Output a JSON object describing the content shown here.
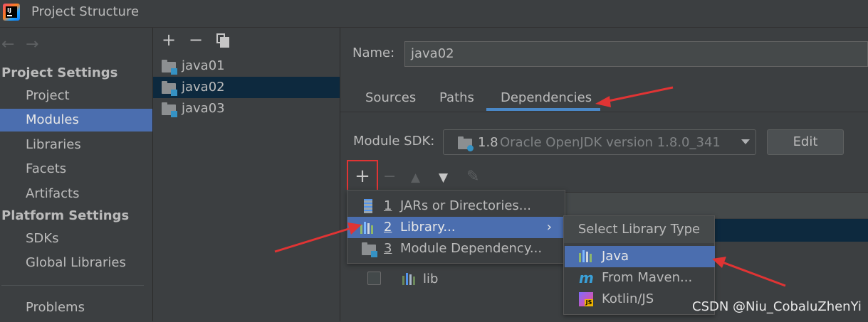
{
  "window": {
    "title": "Project Structure"
  },
  "nav": {
    "back_arrow": "←",
    "forward_arrow": "→",
    "project_settings_header": "Project Settings",
    "project_settings_items": [
      "Project",
      "Modules",
      "Libraries",
      "Facets",
      "Artifacts"
    ],
    "platform_settings_header": "Platform Settings",
    "platform_settings_items": [
      "SDKs",
      "Global Libraries"
    ],
    "problems": "Problems",
    "selected": "Modules"
  },
  "modules": {
    "toolbar": {
      "add": "+",
      "remove": "−"
    },
    "items": [
      "java01",
      "java02",
      "java03"
    ],
    "selected": "java02"
  },
  "module_settings": {
    "name_label": "Name:",
    "name_value": "java02",
    "tabs": [
      "Sources",
      "Paths",
      "Dependencies"
    ],
    "active_tab": "Dependencies",
    "sdk_label": "Module SDK:",
    "sdk_version": "1.8",
    "sdk_detail": "Oracle OpenJDK version 1.8.0_341",
    "edit_button": "Edit",
    "dep_toolbar": {
      "add": "+",
      "remove": "−",
      "up": "▲",
      "down": "▼",
      "edit": "✎"
    },
    "dependencies": [
      {
        "name": "lib",
        "checked": false
      }
    ]
  },
  "add_menu": {
    "items": [
      {
        "num": "1",
        "label": "JARs or Directories...",
        "icon": "jar-icon"
      },
      {
        "num": "2",
        "label": "Library...",
        "icon": "library-icon",
        "submenu": true
      },
      {
        "num": "3",
        "label": "Module Dependency...",
        "icon": "module-folder-icon"
      }
    ],
    "selected": "Library...",
    "chevron": "›"
  },
  "library_type_menu": {
    "title": "Select Library Type",
    "items": [
      {
        "label": "Java",
        "icon": "library-icon"
      },
      {
        "label": "From Maven...",
        "icon": "maven-icon"
      },
      {
        "label": "Kotlin/JS",
        "icon": "kotlin-js-icon"
      }
    ],
    "selected": "Java",
    "maven_glyph": "m",
    "js_glyph": "JS"
  },
  "colors": {
    "background": "#3c3f41",
    "selection": "#4b6eaf",
    "inactive_selection": "#0d293e",
    "annotation": "#e03434",
    "tab_underline": "#4a88c7"
  },
  "watermark": "CSDN @Niu_CobaluZhenYi"
}
